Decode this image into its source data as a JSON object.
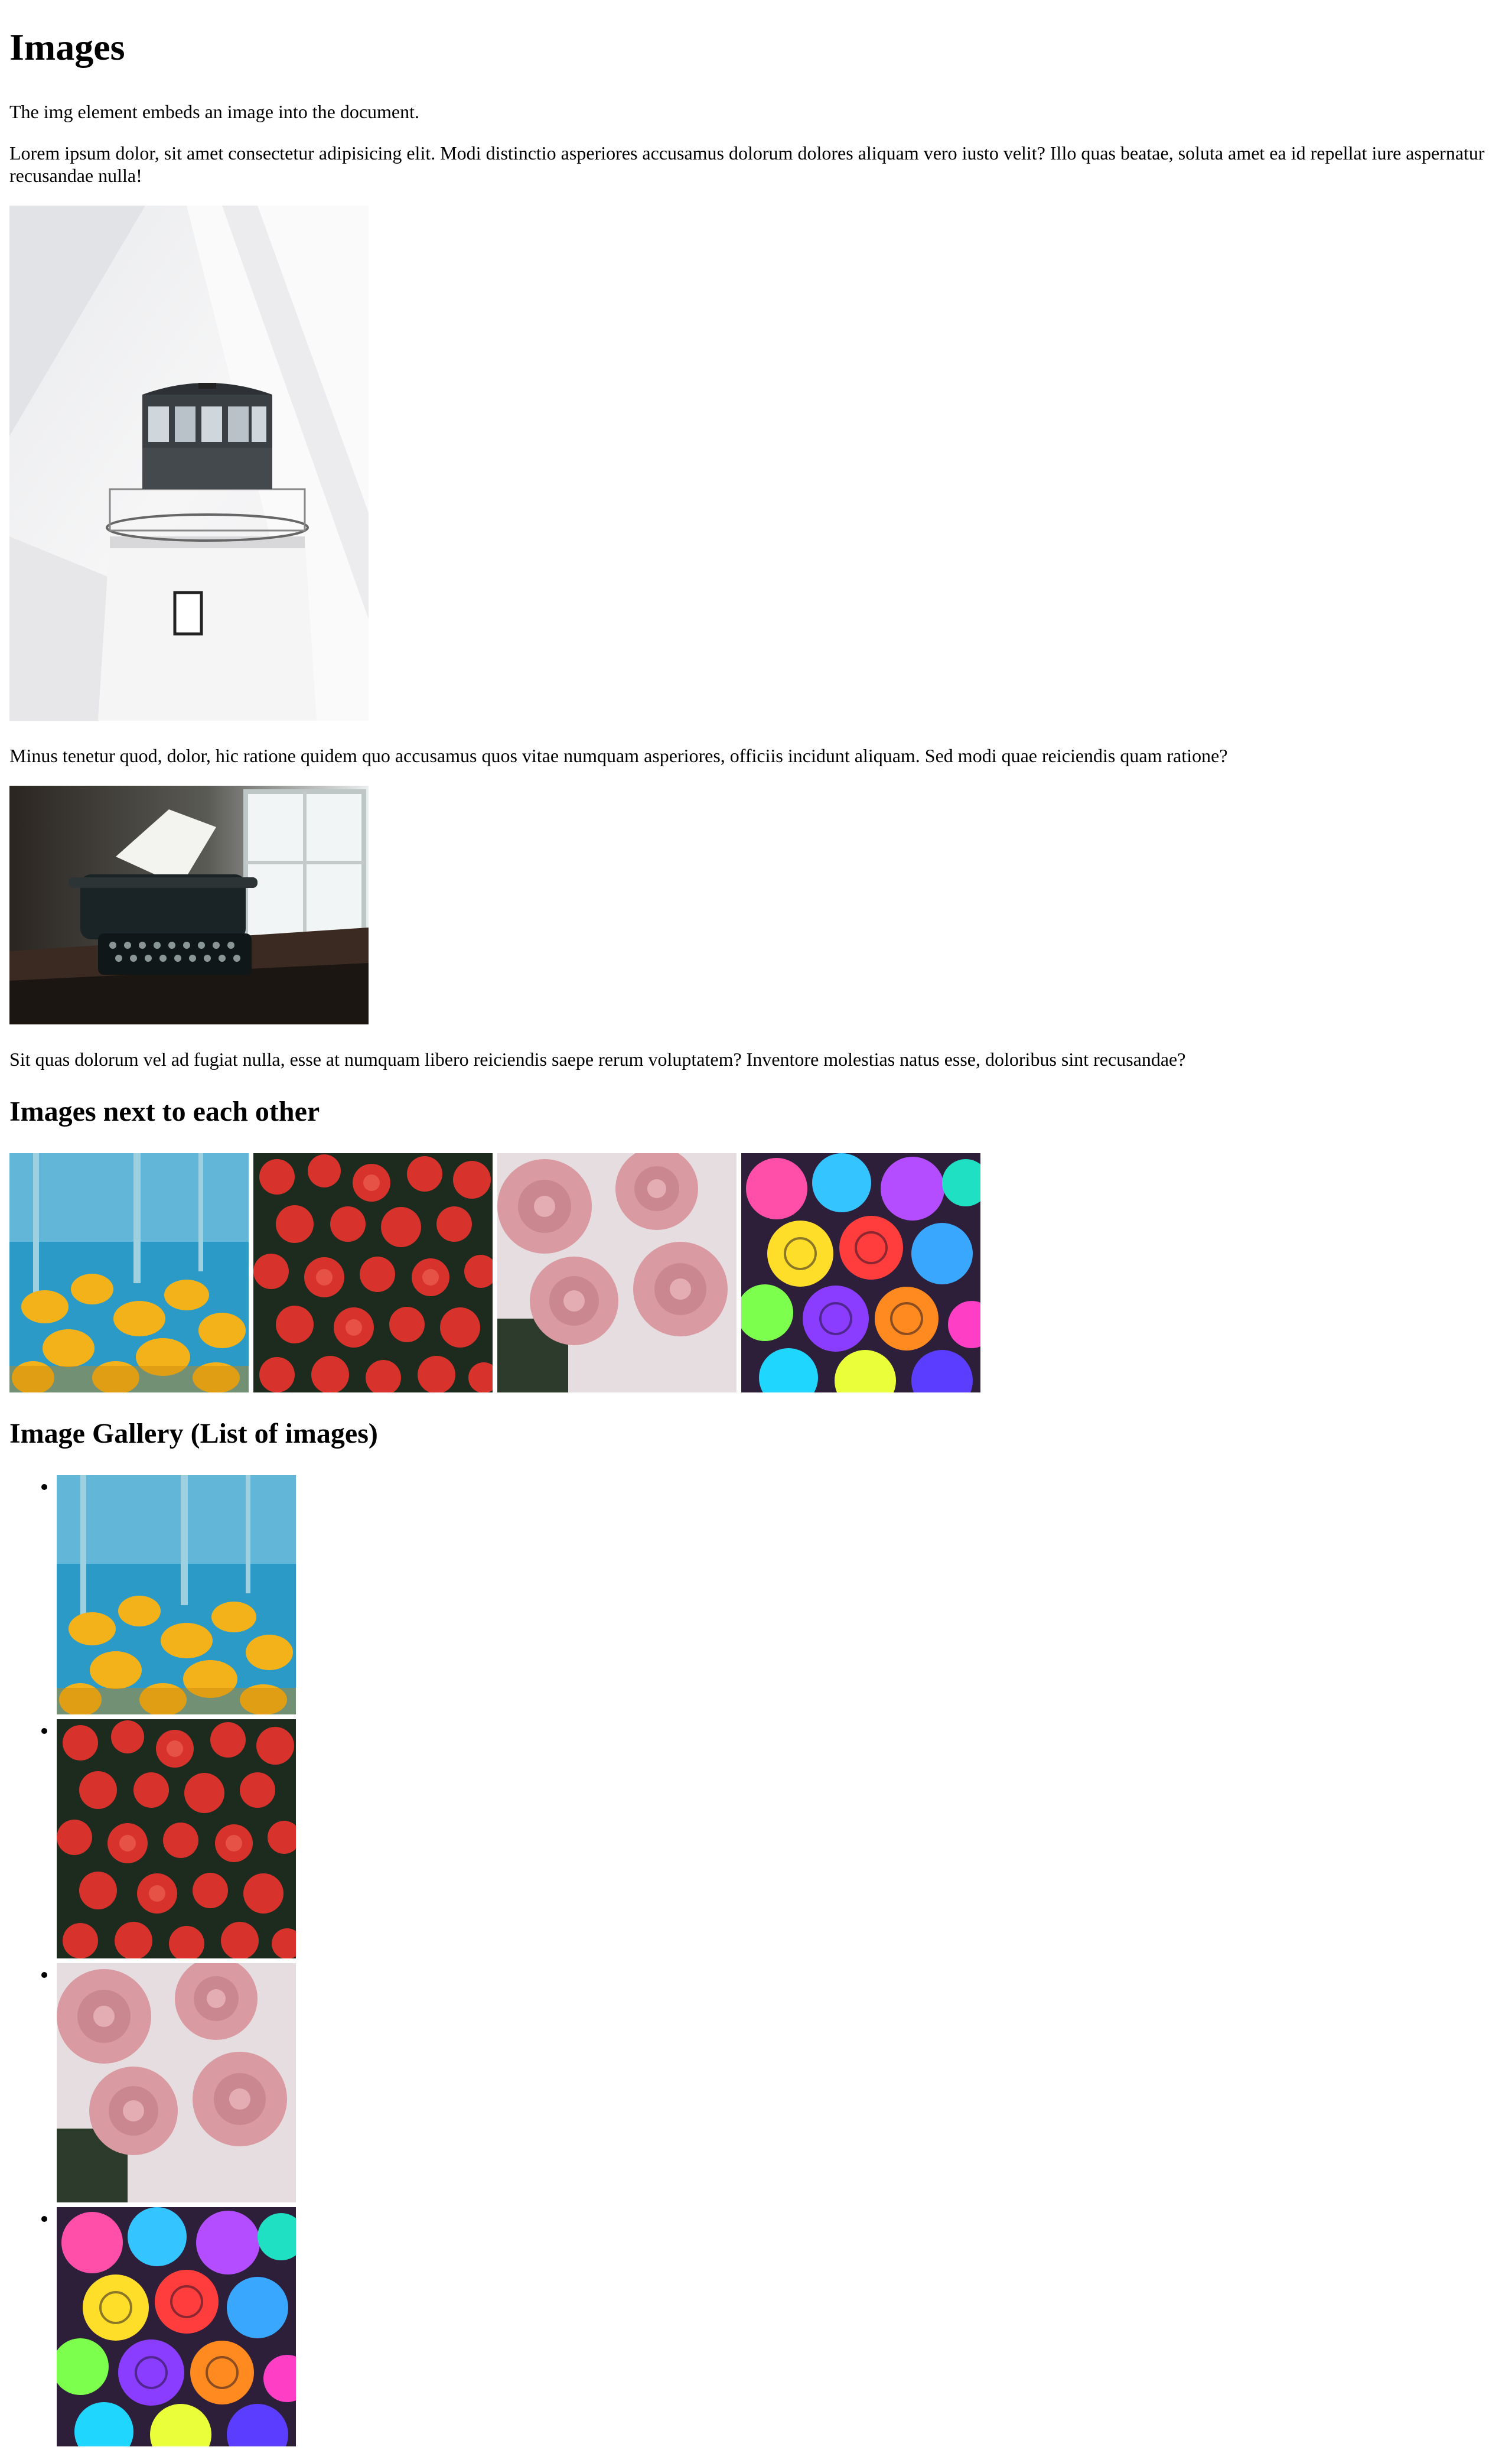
{
  "page": {
    "title": "Images",
    "intro": "The img element embeds an image into the document.",
    "lorem_1": "Lorem ipsum dolor, sit amet consectetur adipisicing elit. Modi distinctio asperiores accusamus dolorum dolores aliquam vero iusto velit? Illo quas beatae, soluta amet ea id repellat iure aspernatur recusandae nulla!",
    "lorem_2": "Minus tenetur quod, dolor, hic ratione quidem quo accusamus quos vitae numquam asperiores, officiis incidunt aliquam. Sed modi quae reiciendis quam ratione?",
    "lorem_3": "Sit quas dolorum vel ad fugiat nulla, esse at numquam libero reiciendis saepe rerum voluptatem? Inventore molestias natus esse, doloribus sint recusandae?",
    "section_row_heading": "Images next to each other",
    "section_gallery_heading": "Image Gallery (List of images)"
  },
  "images": {
    "lighthouse": "lighthouse-photo",
    "typewriter": "typewriter-photo",
    "row": [
      "yellow-flowers-photo",
      "red-flowers-photo",
      "pink-roses-photo",
      "rainbow-roses-photo"
    ],
    "gallery": [
      "yellow-flowers-photo",
      "red-flowers-photo",
      "pink-roses-photo",
      "rainbow-roses-photo"
    ]
  },
  "colors": {
    "text": "#000000",
    "background": "#ffffff"
  }
}
